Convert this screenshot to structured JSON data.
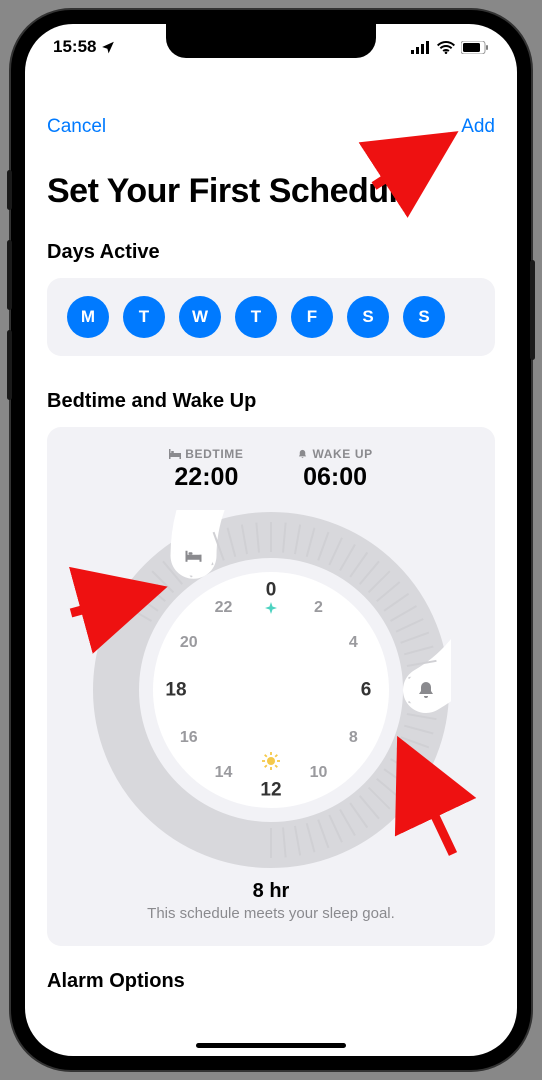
{
  "status": {
    "time": "15:58"
  },
  "nav": {
    "cancel": "Cancel",
    "add": "Add"
  },
  "title": "Set Your First Schedule",
  "days": {
    "label": "Days Active",
    "items": [
      "M",
      "T",
      "W",
      "T",
      "F",
      "S",
      "S"
    ]
  },
  "sleep": {
    "label": "Bedtime and Wake Up",
    "bed_label": "BEDTIME",
    "wake_label": "WAKE UP",
    "bed_time": "22:00",
    "wake_time": "06:00",
    "duration": "8 hr",
    "note": "This schedule meets your sleep goal."
  },
  "clock": {
    "numbers": [
      "0",
      "2",
      "4",
      "6",
      "8",
      "10",
      "12",
      "14",
      "16",
      "18",
      "20",
      "22"
    ]
  },
  "alarm": {
    "label": "Alarm Options"
  },
  "colors": {
    "accent": "#007AFF",
    "arrow": "#E11",
    "panel": "#f2f2f6",
    "muted": "#8a8a8e"
  }
}
